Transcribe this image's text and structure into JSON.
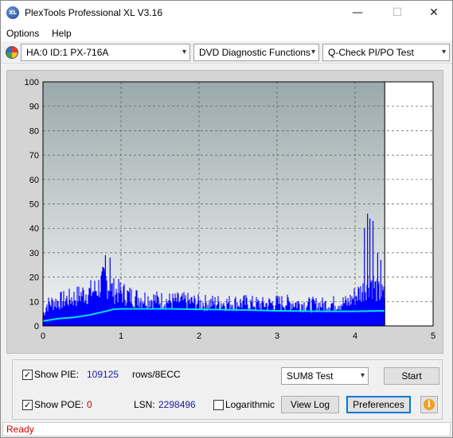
{
  "window": {
    "title": "PlexTools Professional XL V3.16",
    "icon_text": "XL",
    "controls": {
      "minimize": "—",
      "maximize": "☐",
      "close": "✕"
    }
  },
  "menu": {
    "options": "Options",
    "help": "Help"
  },
  "toolbar": {
    "drive": "HA:0 ID:1  PX-716A",
    "function": "DVD Diagnostic Functions",
    "test": "Q-Check PI/PO Test"
  },
  "chart_data": {
    "type": "area",
    "title": "",
    "xlabel": "",
    "ylabel": "",
    "xlim": [
      0,
      5
    ],
    "ylim": [
      0,
      100
    ],
    "x_ticks": [
      "0",
      "1",
      "2",
      "3",
      "4",
      "5"
    ],
    "y_ticks": [
      "0",
      "10",
      "20",
      "30",
      "40",
      "50",
      "60",
      "70",
      "80",
      "90",
      "100"
    ],
    "grid": true,
    "scan_end_x": 4.38,
    "colors": {
      "pie": "#0000ff",
      "sum8": "#00e5e5",
      "plot_bg_top": "#9aa9ab",
      "plot_bg_bottom": "#f2f4f4",
      "unscanned": "#ffffff"
    },
    "series": [
      {
        "name": "PIE",
        "x": [
          0.0,
          0.05,
          0.1,
          0.2,
          0.3,
          0.4,
          0.5,
          0.6,
          0.7,
          0.75,
          0.8,
          0.85,
          0.9,
          1.0,
          1.1,
          1.2,
          1.4,
          1.6,
          1.8,
          2.0,
          2.2,
          2.4,
          2.6,
          2.8,
          3.0,
          3.2,
          3.4,
          3.6,
          3.8,
          3.9,
          4.0,
          4.1,
          4.15,
          4.2,
          4.25,
          4.3,
          4.38
        ],
        "values": [
          6,
          12,
          13,
          14,
          15,
          16,
          18,
          19,
          21,
          24,
          26,
          22,
          20,
          19,
          17,
          16,
          15,
          14,
          14,
          13,
          13,
          13,
          13,
          12,
          13,
          13,
          12,
          12,
          13,
          13,
          17,
          20,
          24,
          26,
          22,
          19,
          17
        ]
      },
      {
        "name": "SUM8",
        "x": [
          0.0,
          0.2,
          0.4,
          0.6,
          0.8,
          0.9,
          1.0,
          1.2,
          1.6,
          2.0,
          2.6,
          3.0,
          3.6,
          4.0,
          4.38
        ],
        "values": [
          2,
          3,
          3.5,
          4.5,
          6,
          6.8,
          7,
          7,
          7,
          6.8,
          6.5,
          6.2,
          6,
          6,
          6.2
        ]
      }
    ],
    "spikes": [
      {
        "x": 0.8,
        "value": 29
      },
      {
        "x": 0.86,
        "value": 28
      },
      {
        "x": 4.12,
        "value": 40
      },
      {
        "x": 4.16,
        "value": 46
      },
      {
        "x": 4.19,
        "value": 44
      },
      {
        "x": 4.23,
        "value": 43
      },
      {
        "x": 4.29,
        "value": 30
      },
      {
        "x": 4.33,
        "value": 27
      }
    ]
  },
  "controls": {
    "show_pie_label": "Show PIE:",
    "pie_value": "109125",
    "pie_unit": "rows/8ECC",
    "show_poe_label": "Show POE:",
    "poe_value": "0",
    "lsn_label": "LSN:",
    "lsn_value": "2298496",
    "logarithmic_label": "Logarithmic",
    "mode_select": "SUM8 Test",
    "start_button": "Start",
    "view_log_button": "View Log",
    "preferences_button": "Preferences",
    "info_glyph": "i",
    "checkbox_checked_glyph": "✓"
  },
  "status": {
    "text": "Ready"
  }
}
